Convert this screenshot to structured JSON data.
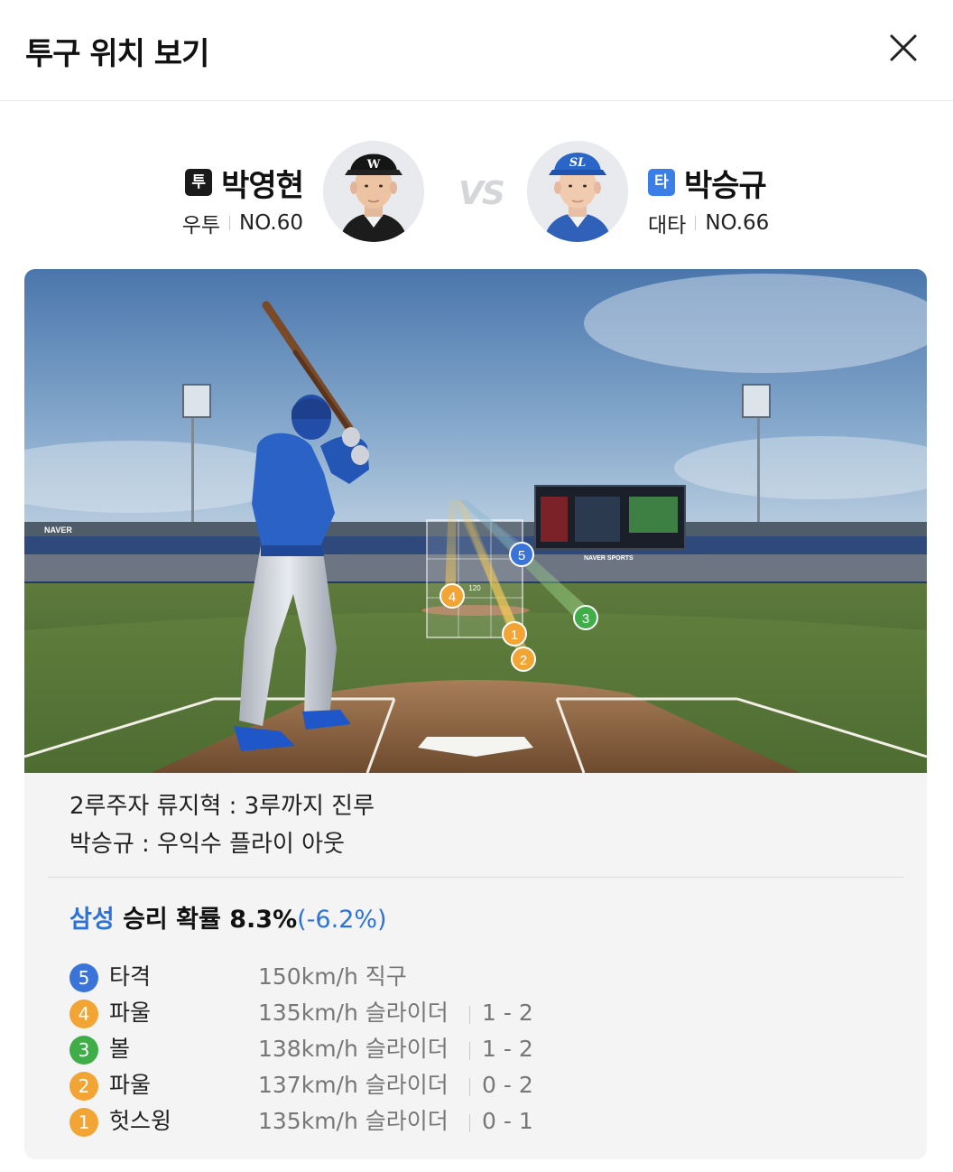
{
  "header": {
    "title": "투구 위치 보기"
  },
  "pitcher": {
    "role": "투",
    "name": "박영현",
    "hand": "우투",
    "number": "NO.60",
    "cap_logo": "W"
  },
  "vs_label": "VS",
  "batter": {
    "role": "타",
    "name": "박승규",
    "hand": "대타",
    "number": "NO.66",
    "cap_logo": "SL"
  },
  "scene": {
    "ad_boards": [
      "NAVER",
      "NAVER SPORTS"
    ],
    "markers": [
      {
        "num": "5",
        "color": "#3a74d9"
      },
      {
        "num": "4",
        "color": "#f2a534"
      },
      {
        "num": "3",
        "color": "#3fae49"
      },
      {
        "num": "2",
        "color": "#f2a534"
      },
      {
        "num": "1",
        "color": "#f2a534"
      }
    ],
    "zone_label": "120"
  },
  "play": {
    "line1": "2루주자 류지혁 : 3루까지 진루",
    "line2": "박승규 : 우익수 플라이 아웃"
  },
  "win_probability": {
    "team": "삼성",
    "label": "승리 확률",
    "value": "8.3%",
    "change": "(-6.2%)"
  },
  "pitches": [
    {
      "num": "5",
      "result": "타격",
      "speed": "150km/h 직구",
      "count": "",
      "color": "blue"
    },
    {
      "num": "4",
      "result": "파울",
      "speed": "135km/h 슬라이더",
      "count": "1 - 2",
      "color": "orange"
    },
    {
      "num": "3",
      "result": "볼",
      "speed": "138km/h 슬라이더",
      "count": "1 - 2",
      "color": "green"
    },
    {
      "num": "2",
      "result": "파울",
      "speed": "137km/h 슬라이더",
      "count": "0 - 2",
      "color": "orange"
    },
    {
      "num": "1",
      "result": "헛스윙",
      "speed": "135km/h 슬라이더",
      "count": "0 - 1",
      "color": "orange"
    }
  ]
}
